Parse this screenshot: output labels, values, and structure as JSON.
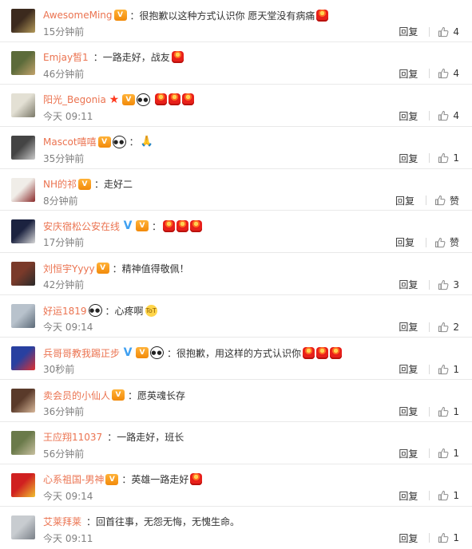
{
  "comments": [
    {
      "name": "AwesomeMing",
      "badges": [
        "vip"
      ],
      "text": "：很抱歉以这种方式认识你 愿天堂没有病痛",
      "emoji_after": [
        "candle-emoji"
      ],
      "time": "15分钟前",
      "reply": "回复",
      "likes": "4",
      "avatar_colors": [
        "#3c2a1e",
        "#b49a5a"
      ]
    },
    {
      "name": "Emjay皙1",
      "badges": [],
      "text": "：一路走好，战友",
      "emoji_after": [
        "candle-emoji"
      ],
      "time": "46分钟前",
      "reply": "回复",
      "likes": "4",
      "avatar_colors": [
        "#5c6b3a",
        "#c2a36c"
      ]
    },
    {
      "name": "阳光_Begonia",
      "badges": [
        "star",
        "vip",
        "panda-emoji"
      ],
      "text": "",
      "emoji_after": [
        "candle-emoji",
        "candle-emoji",
        "candle-emoji"
      ],
      "time": "今天 09:11",
      "reply": "回复",
      "likes": "4",
      "avatar_colors": [
        "#e3e0d4",
        "#7a7868"
      ]
    },
    {
      "name": "Mascot嘻嘻",
      "badges": [
        "vip",
        "panda-emoji"
      ],
      "text": "：",
      "emoji_after": [
        "pray-emoji"
      ],
      "time": "35分钟前",
      "reply": "回复",
      "likes": "1",
      "avatar_colors": [
        "#444444",
        "#c9c9c9"
      ]
    },
    {
      "name": "NH的祁",
      "badges": [
        "vip"
      ],
      "text": "：走好二",
      "emoji_after": [],
      "time": "8分钟前",
      "reply": "回复",
      "likes": "赞",
      "avatar_colors": [
        "#f0ede8",
        "#8a2a2a"
      ]
    },
    {
      "name": "安庆宿松公安在线",
      "badges": [
        "v",
        "vip"
      ],
      "text": "：",
      "emoji_after": [
        "candle-emoji",
        "candle-emoji",
        "candle-emoji"
      ],
      "time": "17分钟前",
      "reply": "回复",
      "likes": "赞",
      "avatar_colors": [
        "#1c2340",
        "#d8d8d8"
      ]
    },
    {
      "name": "刘恒宇Yyyy",
      "badges": [
        "vip"
      ],
      "text": "：精神值得敬佩！",
      "emoji_after": [],
      "time": "42分钟前",
      "reply": "回复",
      "likes": "3",
      "avatar_colors": [
        "#7a3a2a",
        "#2a2a2a"
      ]
    },
    {
      "name": "好运1819",
      "badges": [
        "panda-emoji"
      ],
      "text": "：心疼啊",
      "emoji_after": [
        "cry-emoji"
      ],
      "time": "今天 09:14",
      "reply": "回复",
      "likes": "2",
      "avatar_colors": [
        "#b8c2cc",
        "#5c6a78"
      ]
    },
    {
      "name": "兵哥哥教我踢正步",
      "badges": [
        "v",
        "vip",
        "panda-emoji"
      ],
      "text": "：很抱歉，用这样的方式认识你",
      "emoji_after": [
        "candle-emoji",
        "candle-emoji",
        "candle-emoji"
      ],
      "time": "30秒前",
      "reply": "回复",
      "likes": "1",
      "avatar_colors": [
        "#2840a0",
        "#e03030"
      ]
    },
    {
      "name": "卖会员的小仙人",
      "badges": [
        "vip"
      ],
      "text": "：愿英魂长存",
      "emoji_after": [],
      "time": "36分钟前",
      "reply": "回复",
      "likes": "1",
      "avatar_colors": [
        "#5a3a2a",
        "#d8b89a"
      ]
    },
    {
      "name": "王应翔11037",
      "badges": [],
      "text": "：一路走好，班长",
      "emoji_after": [],
      "time": "56分钟前",
      "reply": "回复",
      "likes": "1",
      "avatar_colors": [
        "#6a7a4a",
        "#c8c0a0"
      ]
    },
    {
      "name": "心系祖国-男神",
      "badges": [
        "vip"
      ],
      "text": "：英雄一路走好",
      "emoji_after": [
        "candle-emoji"
      ],
      "time": "今天 09:14",
      "reply": "回复",
      "likes": "1",
      "avatar_colors": [
        "#d02020",
        "#f0c030"
      ]
    },
    {
      "name": "艾莱拜莱",
      "badges": [],
      "text": "：回首往事，无怨无悔，无愧生命。",
      "emoji_after": [],
      "time": "今天 09:11",
      "reply": "回复",
      "likes": "1",
      "avatar_colors": [
        "#c8ccd0",
        "#7a8088"
      ]
    }
  ],
  "colors": {
    "name": "#eb7350",
    "meta": "#808080",
    "text": "#333333",
    "separator": "#e9e9e9"
  },
  "icons": {
    "like": "thumbs-up-icon",
    "vip": "vip-crown-icon",
    "verified": "verified-v-icon"
  },
  "badge_text": {
    "vip": "V",
    "v": "V",
    "star": "★",
    "panda": "●●",
    "pray": "🙏",
    "cry": "ToT"
  }
}
